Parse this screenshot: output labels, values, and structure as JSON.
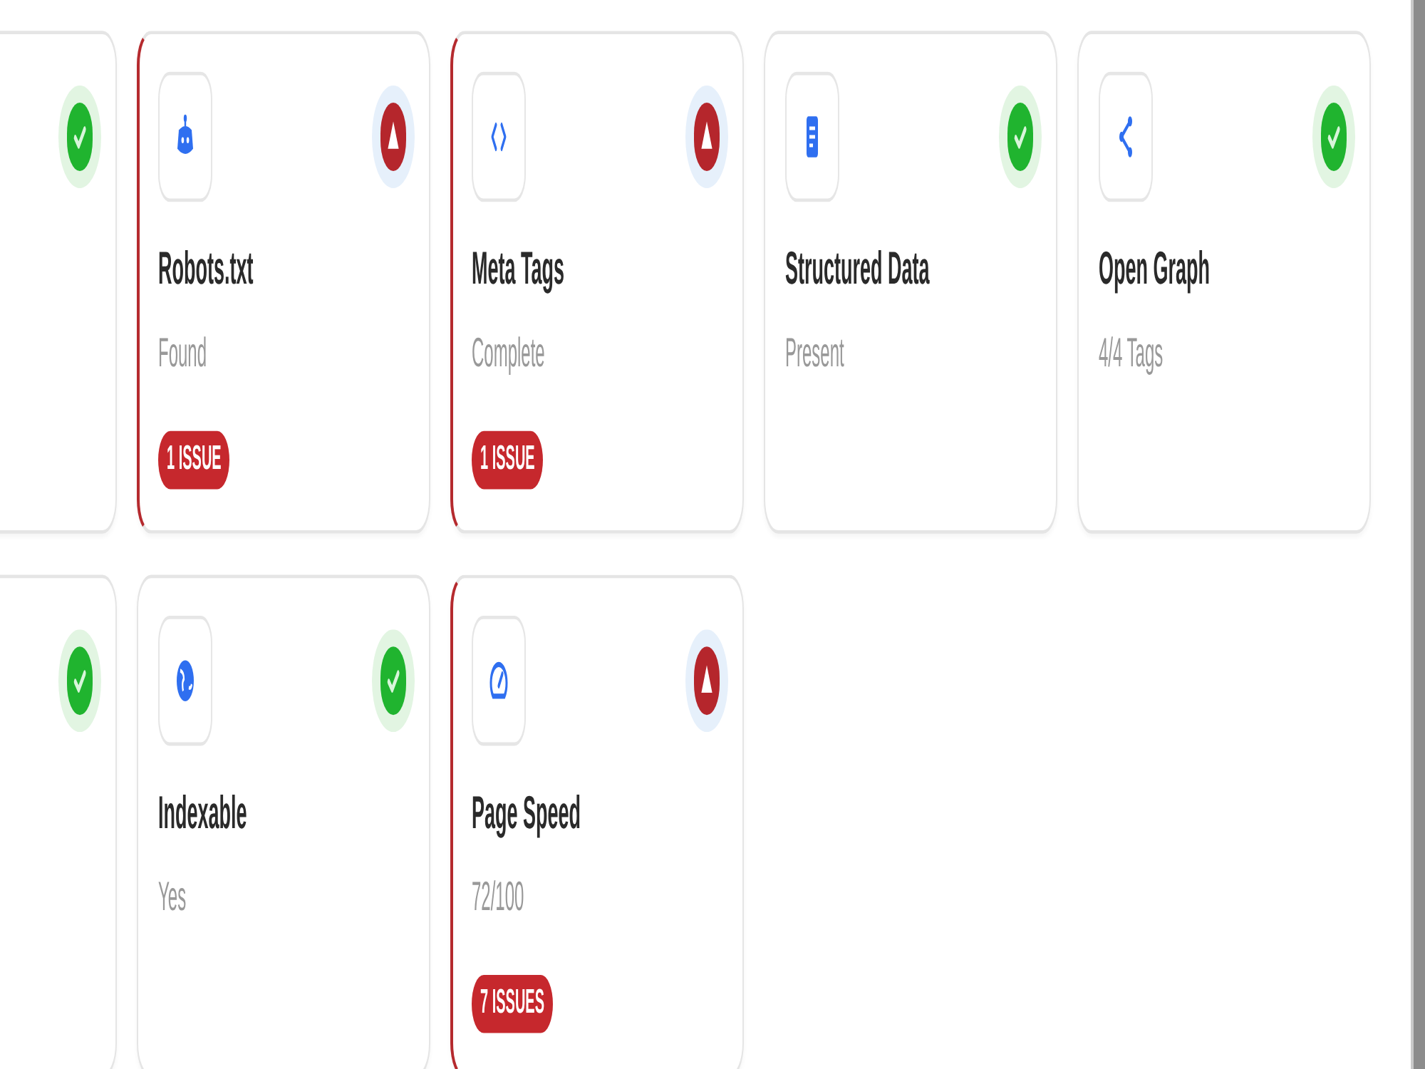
{
  "checks": [
    {
      "passed": true
    },
    {
      "title": "Robots.txt",
      "value": "Found",
      "passed": false,
      "issues": "1 ISSUE"
    },
    {
      "title": "Meta Tags",
      "value": "Complete",
      "passed": false,
      "issues": "1 ISSUE"
    },
    {
      "title": "Structured Data",
      "value": "Present",
      "passed": true
    },
    {
      "title": "Open Graph",
      "value": "4/4 Tags",
      "passed": true
    },
    {
      "passed": true
    },
    {
      "title": "Indexable",
      "value": "Yes",
      "passed": true
    },
    {
      "title": "Page Speed",
      "value": "72/100",
      "passed": false,
      "issues": "7 ISSUES"
    }
  ]
}
